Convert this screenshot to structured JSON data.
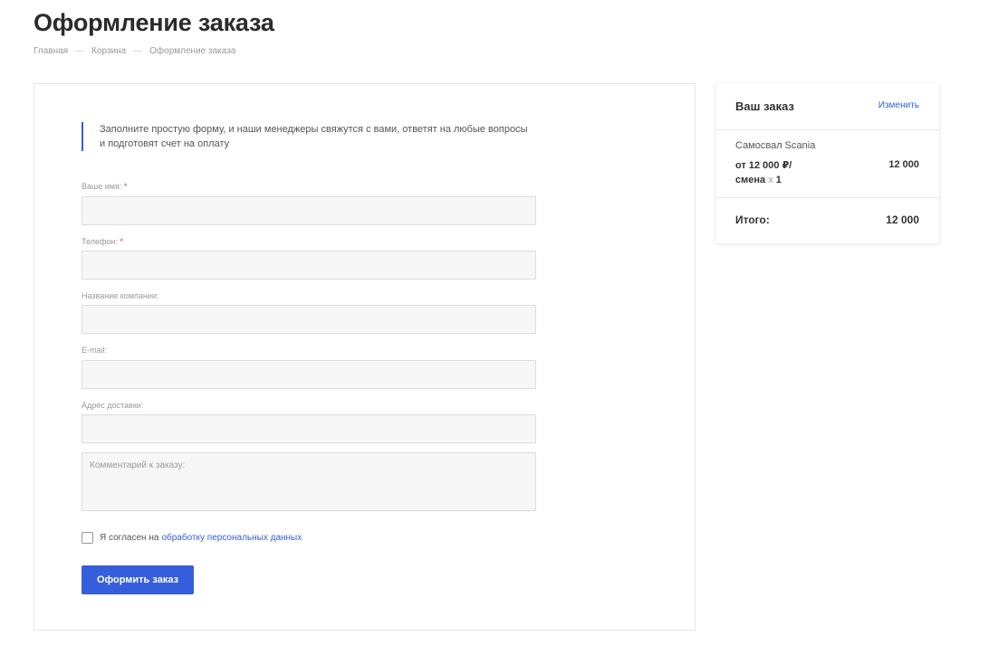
{
  "page": {
    "title": "Оформление заказа"
  },
  "breadcrumb": {
    "items": [
      "Главная",
      "Корзина",
      "Оформление заказа"
    ],
    "separator": "—"
  },
  "form": {
    "intro_line1": "Заполните простую форму, и наши менеджеры свяжутся с вами, ответят на любые вопросы",
    "intro_line2": "и подготовят счет на оплату",
    "required_mark": "*",
    "fields": [
      {
        "label": "Ваше имя:",
        "required": true,
        "value": ""
      },
      {
        "label": "Телефон:",
        "required": true,
        "value": ""
      },
      {
        "label": "Название компании:",
        "required": false,
        "value": ""
      },
      {
        "label": "E-mail:",
        "required": false,
        "value": ""
      },
      {
        "label": "Адрес доставки:",
        "required": false,
        "value": ""
      }
    ],
    "comment_placeholder": "Комментарий к заказу:",
    "consent_text": "Я согласен на",
    "consent_link": "обработку персональных данных",
    "consent_checked": false,
    "submit_label": "Оформить заказ"
  },
  "order": {
    "title": "Ваш заказ",
    "edit_label": "Изменить",
    "items": [
      {
        "name": "Самосвал Scania",
        "price_line1": "от 12 000 ₽/",
        "price_unit": "смена",
        "qty_sep": "x",
        "qty": "1",
        "sum": "12 000"
      }
    ],
    "total_label": "Итого:",
    "total_value": "12 000"
  },
  "colors": {
    "accent": "#365edc",
    "required": "#e53935",
    "input_bg": "#f7f7f7"
  }
}
